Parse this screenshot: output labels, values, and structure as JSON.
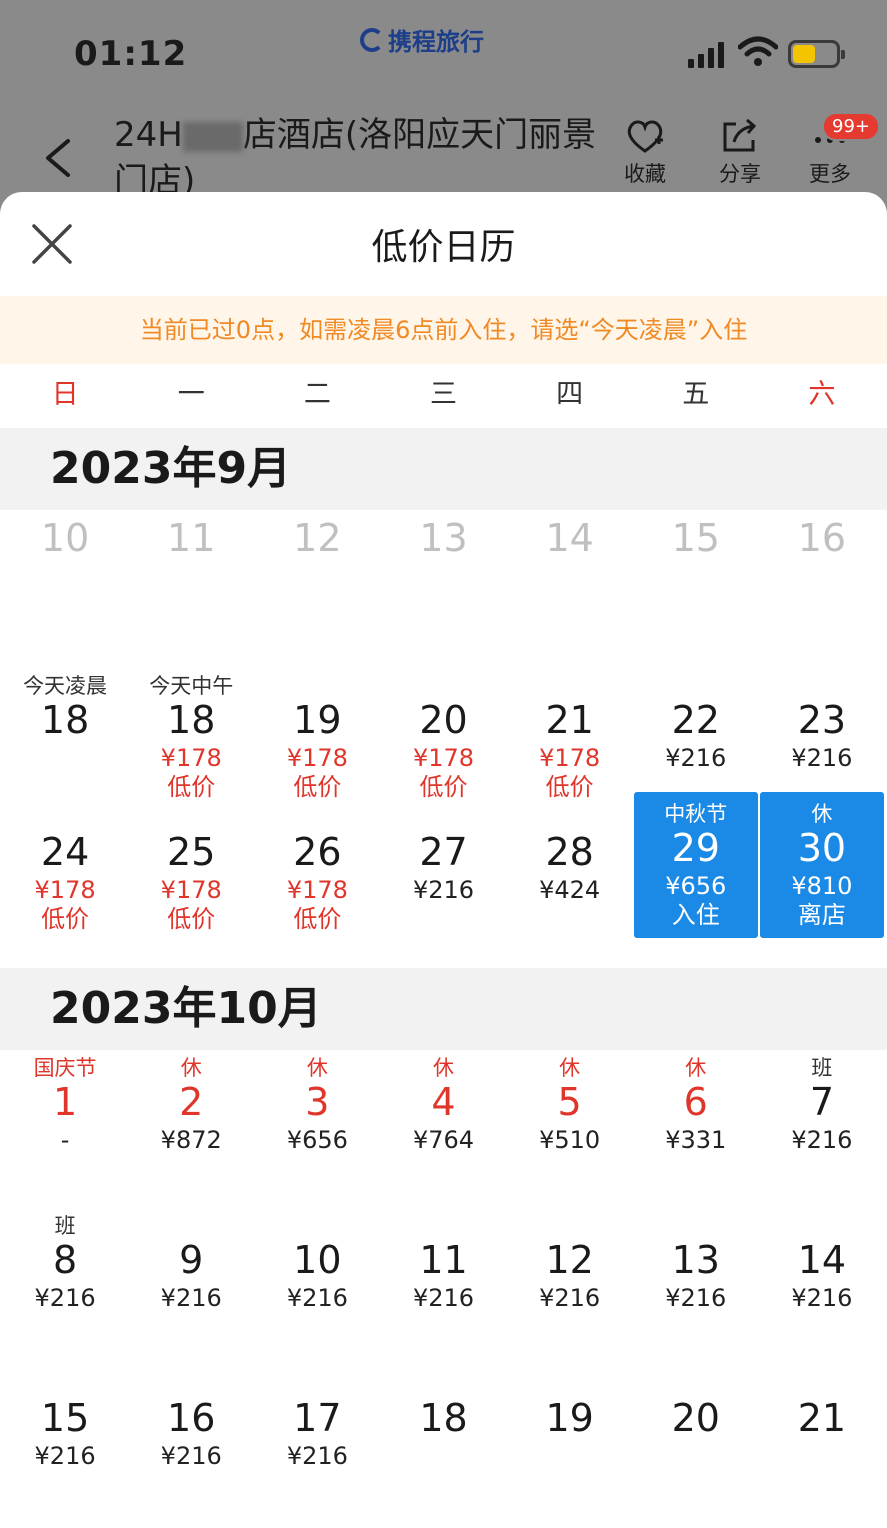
{
  "status": {
    "time": "01:12"
  },
  "brand": {
    "name": "携程旅行"
  },
  "header": {
    "hotel_name_visible_start": "24H",
    "hotel_name_visible_end": "店酒店(洛阳应天门丽景门店)",
    "favorite_label": "收藏",
    "share_label": "分享",
    "more_label": "更多",
    "badge": "99+"
  },
  "sheet": {
    "title": "低价日历",
    "notice": "当前已过0点，如需凌晨6点前入住，请选“今天凌晨”入住"
  },
  "weekdays": [
    "日",
    "一",
    "二",
    "三",
    "四",
    "五",
    "六"
  ],
  "colors": {
    "accent_blue": "#1a8ae6",
    "price_red": "#e0352b",
    "notice_orange": "#f08a24",
    "notice_bg": "#fff5e9"
  },
  "months": [
    {
      "title": "2023年9月",
      "weeks": [
        [
          {
            "day": "10",
            "past": true
          },
          {
            "day": "11",
            "past": true
          },
          {
            "day": "12",
            "past": true
          },
          {
            "day": "13",
            "past": true
          },
          {
            "day": "14",
            "past": true
          },
          {
            "day": "15",
            "past": true
          },
          {
            "day": "16",
            "past": true
          }
        ],
        [
          {
            "tag": "今天凌晨",
            "day": "18"
          },
          {
            "tag": "今天中午",
            "day": "18",
            "price": "¥178",
            "note": "低价",
            "low": true
          },
          {
            "day": "19",
            "price": "¥178",
            "note": "低价",
            "low": true
          },
          {
            "day": "20",
            "price": "¥178",
            "note": "低价",
            "low": true
          },
          {
            "day": "21",
            "price": "¥178",
            "note": "低价",
            "low": true
          },
          {
            "day": "22",
            "price": "¥216"
          },
          {
            "day": "23",
            "price": "¥216"
          }
        ],
        [
          {
            "day": "24",
            "price": "¥178",
            "note": "低价",
            "low": true
          },
          {
            "day": "25",
            "price": "¥178",
            "note": "低价",
            "low": true
          },
          {
            "day": "26",
            "price": "¥178",
            "note": "低价",
            "low": true
          },
          {
            "day": "27",
            "price": "¥216"
          },
          {
            "day": "28",
            "price": "¥424"
          },
          {
            "tag": "中秋节",
            "day": "29",
            "price": "¥656",
            "note": "入住",
            "selected": true
          },
          {
            "tag": "休",
            "day": "30",
            "price": "¥810",
            "note": "离店",
            "selected": true
          }
        ]
      ]
    },
    {
      "title": "2023年10月",
      "weeks": [
        [
          {
            "tag": "国庆节",
            "day": "1",
            "price": "-",
            "holiday": true
          },
          {
            "tag": "休",
            "day": "2",
            "price": "¥872",
            "holiday": true
          },
          {
            "tag": "休",
            "day": "3",
            "price": "¥656",
            "holiday": true
          },
          {
            "tag": "休",
            "day": "4",
            "price": "¥764",
            "holiday": true
          },
          {
            "tag": "休",
            "day": "5",
            "price": "¥510",
            "holiday": true
          },
          {
            "tag": "休",
            "day": "6",
            "price": "¥331",
            "holiday": true
          },
          {
            "tag": "班",
            "day": "7",
            "price": "¥216"
          }
        ],
        [
          {
            "tag": "班",
            "day": "8",
            "price": "¥216"
          },
          {
            "day": "9",
            "price": "¥216"
          },
          {
            "day": "10",
            "price": "¥216"
          },
          {
            "day": "11",
            "price": "¥216"
          },
          {
            "day": "12",
            "price": "¥216"
          },
          {
            "day": "13",
            "price": "¥216"
          },
          {
            "day": "14",
            "price": "¥216"
          }
        ],
        [
          {
            "day": "15",
            "price": "¥216"
          },
          {
            "day": "16",
            "price": "¥216"
          },
          {
            "day": "17",
            "price": "¥216"
          },
          {
            "day": "18"
          },
          {
            "day": "19"
          },
          {
            "day": "20"
          },
          {
            "day": "21"
          }
        ]
      ]
    }
  ]
}
